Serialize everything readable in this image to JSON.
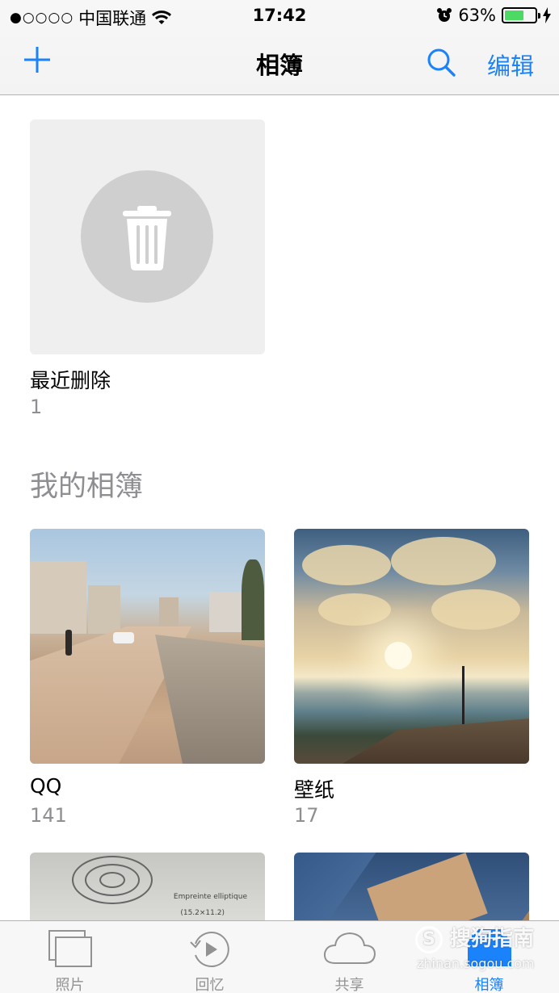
{
  "status_bar": {
    "signal": "●○○○○",
    "carrier": "中国联通",
    "time": "17:42",
    "battery": "63%",
    "battery_level": 0.63
  },
  "nav": {
    "title": "相簿",
    "edit_label": "编辑",
    "add_icon": "plus-icon",
    "search_icon": "search-icon"
  },
  "recently_deleted": {
    "name": "最近删除",
    "count": "1",
    "icon": "trash-icon"
  },
  "my_albums": {
    "title": "我的相簿",
    "albums": [
      {
        "name": "QQ",
        "count": "141"
      },
      {
        "name": "壁纸",
        "count": "17"
      }
    ],
    "peek_text": "Empreinte elliptique",
    "peek_subtext": "(15.2×11.2)"
  },
  "tab_bar": {
    "tabs": [
      {
        "label": "照片",
        "icon": "photos-icon"
      },
      {
        "label": "回忆",
        "icon": "memories-icon"
      },
      {
        "label": "共享",
        "icon": "cloud-icon"
      },
      {
        "label": "相簿",
        "icon": "albums-icon"
      }
    ],
    "active_index": 3
  },
  "watermark": {
    "logo": "搜狗指南",
    "url": "zhinan.sogou.com"
  },
  "colors": {
    "accent": "#1a82fb",
    "secondary_text": "#8e8e93",
    "battery": "#4cd964"
  }
}
